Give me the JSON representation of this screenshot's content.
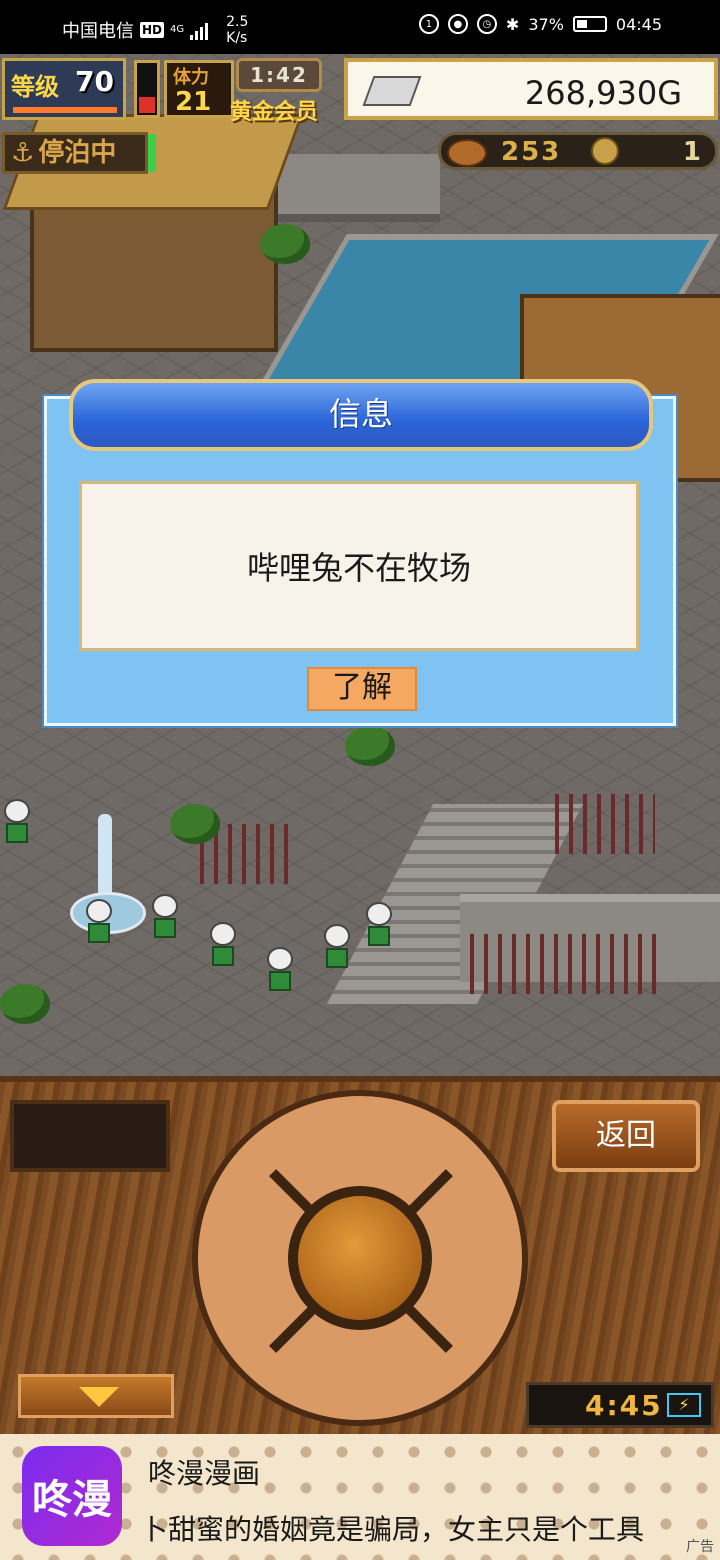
{
  "status_bar": {
    "carrier": "中国电信",
    "hd_badge": "HD",
    "network": "4G",
    "speed_value": "2.5",
    "speed_unit": "K/s",
    "battery": "37%",
    "time": "04:45"
  },
  "hud": {
    "level_label": "等级",
    "level_value": "70",
    "stamina_label": "体力",
    "stamina_value": "21",
    "timer": "1:42",
    "member_label": "黄金会员",
    "gold": "268,930G",
    "anchor_status": "停泊中",
    "resource_count": "253",
    "coin_count": "1"
  },
  "dialog": {
    "title": "信息",
    "message": "哔哩兔不在牧场",
    "ok_label": "了解"
  },
  "panel": {
    "back_label": "返回",
    "clock": "4:45"
  },
  "ad": {
    "logo_text": "咚漫",
    "app_name": "咚漫漫画",
    "text": "卜甜蜜的婚姻竟是骗局，女主只是个工具",
    "tag": "广告"
  }
}
